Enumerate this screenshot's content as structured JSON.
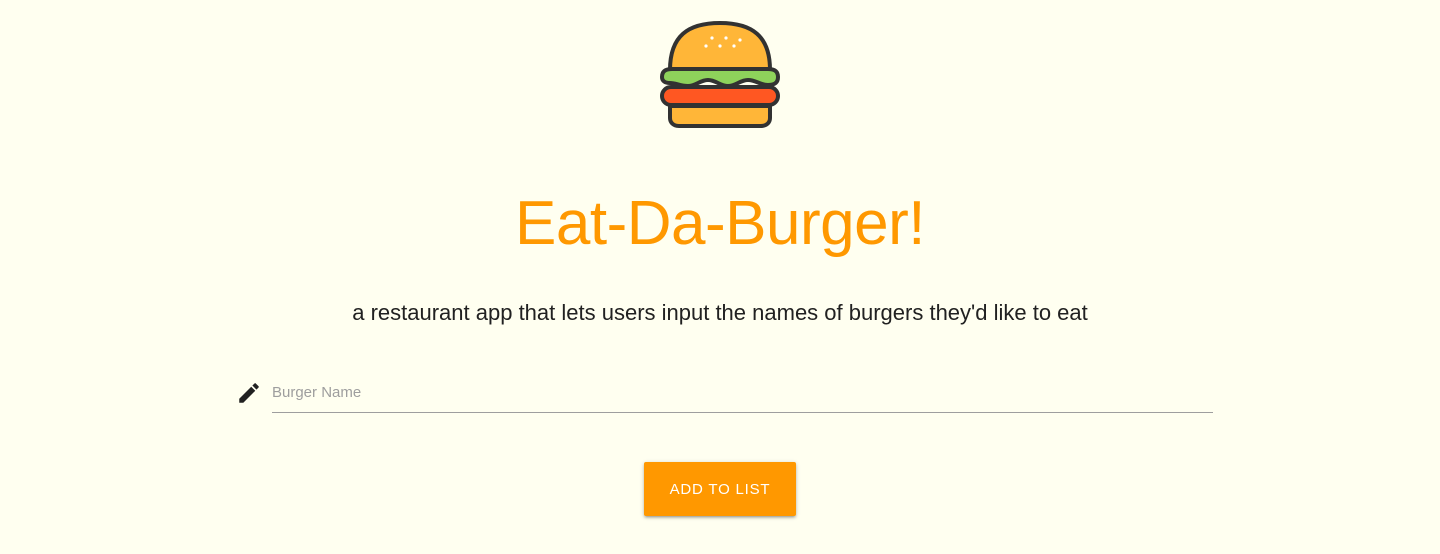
{
  "header": {
    "logo_icon": "burger-icon",
    "title": "Eat-Da-Burger!",
    "subtitle": "a restaurant app that lets users input the names of burgers they'd like to eat"
  },
  "form": {
    "field_icon": "pencil-icon",
    "burger_name": {
      "value": "",
      "placeholder": "Burger Name"
    },
    "submit_label": "Add to List"
  },
  "colors": {
    "background": "#fffff0",
    "accent": "#ff9800",
    "text": "#212121",
    "placeholder": "#9e9e9e"
  }
}
